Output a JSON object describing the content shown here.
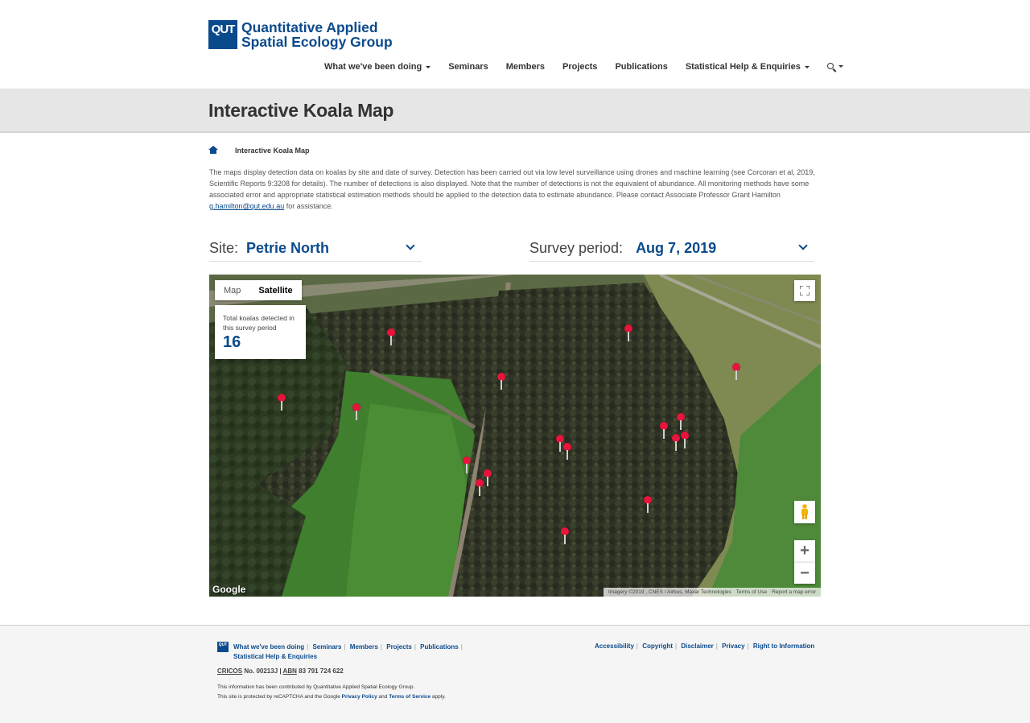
{
  "header": {
    "logo_mark": "QUT",
    "logo_line1": "Quantitative Applied",
    "logo_line2": "Spatial Ecology Group",
    "nav": [
      {
        "label": "What we've been doing",
        "dropdown": true
      },
      {
        "label": "Seminars",
        "dropdown": false
      },
      {
        "label": "Members",
        "dropdown": false
      },
      {
        "label": "Projects",
        "dropdown": false
      },
      {
        "label": "Publications",
        "dropdown": false
      },
      {
        "label": "Statistical Help & Enquiries",
        "dropdown": true
      }
    ],
    "search_icon": "search-icon"
  },
  "page": {
    "title": "Interactive Koala Map",
    "breadcrumb_current": "Interactive Koala Map",
    "intro_part1": "The maps display detection data on koalas by site and date of survey. Detection has been carried out via low level surveillance using drones and machine learning (see Corcoran et al, 2019, Scientific Reports 9:3208 for details). The number of detections is also displayed. Note that the number of detections is not the equivalent of abundance. All monitoring methods have some associated error and appropriate statistical estimation methods should be applied to the detection data to estimate abundance. Please contact Associate Professor Grant Hamilton ",
    "intro_email": "g.hamilton@qut.edu.au",
    "intro_part2": " for assistance."
  },
  "selectors": {
    "site_label": "Site:",
    "site_value": "Petrie North",
    "period_label": "Survey period:",
    "period_value": "Aug 7, 2019"
  },
  "map": {
    "toggle_map": "Map",
    "toggle_satellite": "Satellite",
    "active_type": "Satellite",
    "count_label": "Total koalas detected in this survey period",
    "count_value": "16",
    "zoom_in": "+",
    "zoom_out": "−",
    "google": "Google",
    "attribution": [
      "Imagery ©2019 , CNES / Airbus, Maxar Technologies",
      "Terms of Use",
      "Report a map error"
    ],
    "pin_color": "#e8143c"
  },
  "footer": {
    "logo_mark": "QUT",
    "links_left": [
      "What we've been doing",
      "Seminars",
      "Members",
      "Projects",
      "Publications",
      "Statistical Help & Enquiries"
    ],
    "links_right": [
      "Accessibility",
      "Copyright",
      "Disclaimer",
      "Privacy",
      "Right to Information"
    ],
    "cricos_label": "CRICOS",
    "cricos_text": " No. 00213J | ",
    "abn_label": "ABN",
    "abn_text": " 83 791 724 622",
    "note1": "This information has been contributed by Quantitative Applied Spatial Ecology Group.",
    "note2_pre": "This site is protected by reCAPTCHA and the Google ",
    "note2_privacy": "Privacy Policy",
    "note2_and": " and ",
    "note2_terms": "Terms of Service",
    "note2_post": " apply."
  },
  "colors": {
    "brand": "#0a4a8c",
    "pin": "#e8143c"
  }
}
